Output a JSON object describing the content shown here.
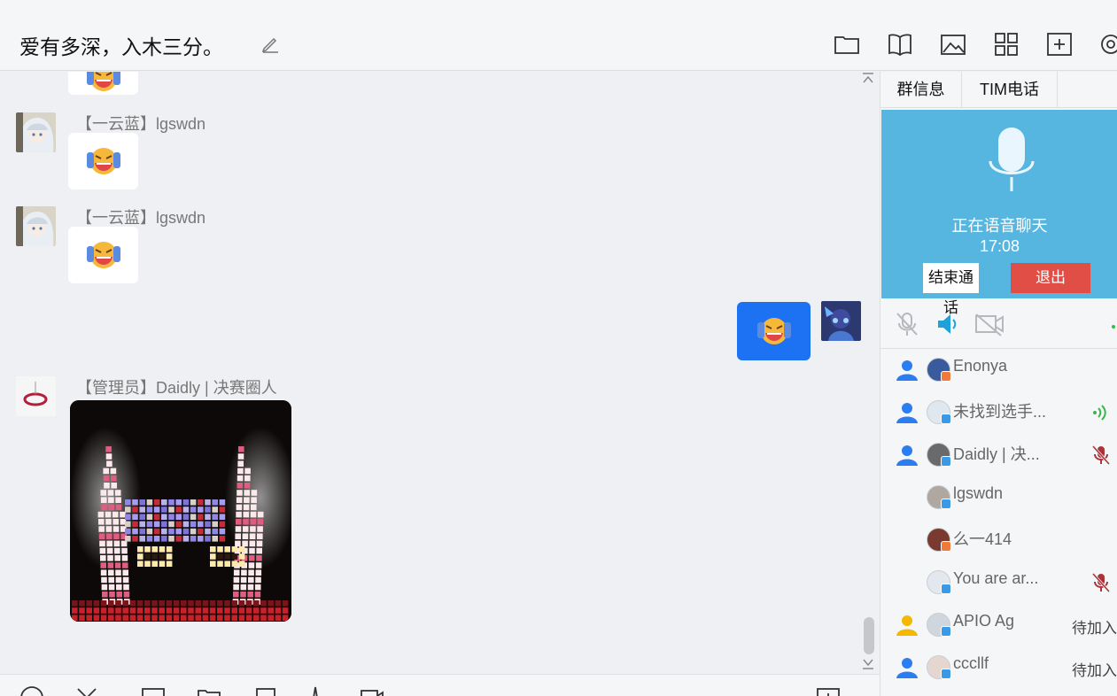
{
  "window": {
    "min_glyph": "–"
  },
  "header": {
    "title": "爱有多深，入木三分。",
    "toolbar": [
      "folder-icon",
      "book-icon",
      "image-icon",
      "apps-icon",
      "add-screen-icon",
      "settings-icon"
    ]
  },
  "messages": [
    {
      "sender": "【一云蓝】lgswdn",
      "type": "emoji",
      "emoji": "laughing-face"
    },
    {
      "sender": "【一云蓝】lgswdn",
      "type": "emoji",
      "emoji": "laughing-face"
    },
    {
      "sender": "me",
      "type": "emoji",
      "emoji": "laughing-face"
    },
    {
      "sender": "【管理员】Daidly | 决赛圈人",
      "type": "sticker",
      "sticker": "pixel-cat-glowing-eyes"
    }
  ],
  "right_panel": {
    "tabs": [
      "群信息",
      "TIM电话"
    ],
    "call": {
      "status": "正在语音聊天",
      "duration": "17:08",
      "end_label": "结束通话",
      "exit_label": "退出"
    },
    "members": [
      {
        "name": "Enonya",
        "role": "admin",
        "indicator": "",
        "status": ""
      },
      {
        "name": "未找到选手...",
        "role": "admin",
        "indicator": "speaking",
        "status": ""
      },
      {
        "name": "Daidly | 决...",
        "role": "admin",
        "indicator": "muted",
        "status": ""
      },
      {
        "name": "lgswdn",
        "role": "member",
        "indicator": "",
        "status": ""
      },
      {
        "name": "么一414",
        "role": "member",
        "indicator": "",
        "status": ""
      },
      {
        "name": "You are ar...",
        "role": "member",
        "indicator": "muted",
        "status": ""
      },
      {
        "name": "APIO Ag",
        "role": "owner",
        "indicator": "",
        "status": "待加入"
      },
      {
        "name": "cccllf",
        "role": "admin",
        "indicator": "",
        "status": "待加入"
      }
    ]
  },
  "colors": {
    "accent": "#1c72f2",
    "call_panel": "#56b6e0",
    "exit_button": "#e04e46",
    "admin_icon": "#2a7ef0",
    "owner_icon": "#f5b800"
  }
}
